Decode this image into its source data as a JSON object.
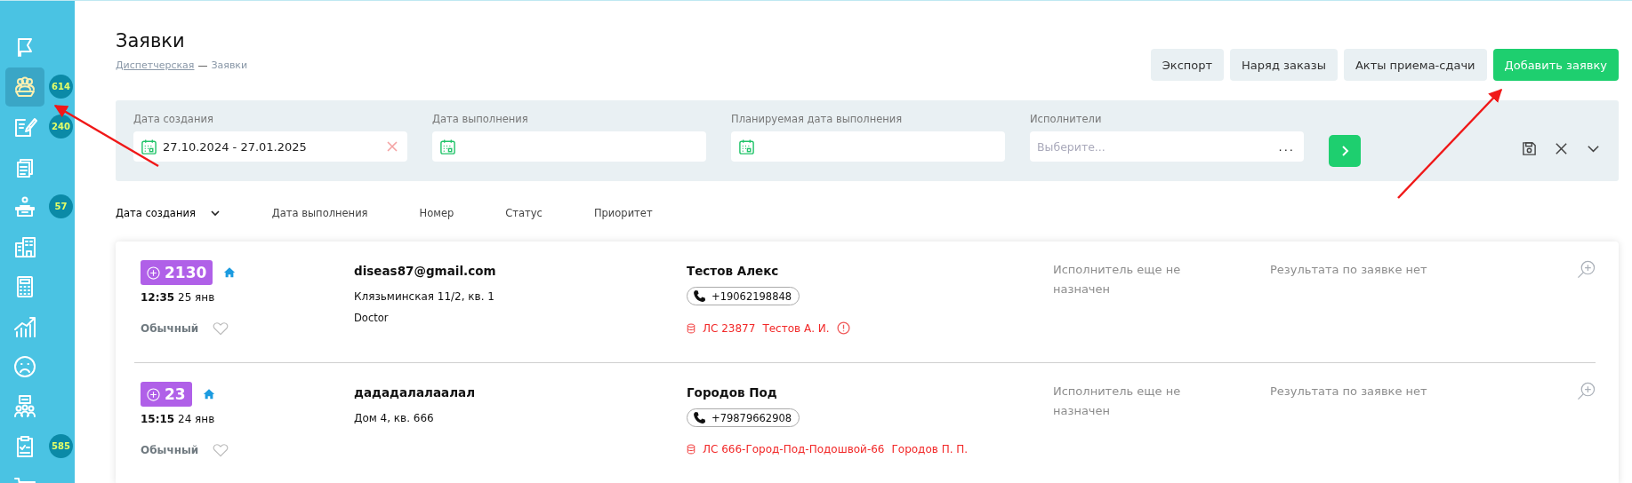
{
  "sidebar": {
    "items": [
      {
        "kind": "flag",
        "selected": false
      },
      {
        "kind": "group",
        "selected": true,
        "badge": "614"
      },
      {
        "kind": "edit",
        "selected": false,
        "badge": "240"
      },
      {
        "kind": "docs",
        "selected": false
      },
      {
        "kind": "reception",
        "selected": false,
        "badge": "57"
      },
      {
        "kind": "building",
        "selected": false
      },
      {
        "kind": "calculator",
        "selected": false
      },
      {
        "kind": "chart",
        "selected": false
      },
      {
        "kind": "sad",
        "selected": false
      },
      {
        "kind": "team",
        "selected": false
      },
      {
        "kind": "clipboard",
        "selected": false,
        "badge": "585"
      },
      {
        "kind": "cart",
        "selected": false
      }
    ]
  },
  "page": {
    "title": "Заявки",
    "breadcrumb": {
      "parent": "Диспетчерская",
      "separator": "—",
      "current": "Заявки"
    }
  },
  "toolbar": {
    "buttons": [
      {
        "label": "Экспорт",
        "kind": "secondary"
      },
      {
        "label": "Наряд заказы",
        "kind": "secondary"
      },
      {
        "label": "Акты приема-сдачи",
        "kind": "secondary"
      },
      {
        "label": "Добавить заявку",
        "kind": "primary"
      }
    ]
  },
  "filters": {
    "fields": [
      {
        "kind": "date",
        "label": "Дата создания",
        "value": "27.10.2024 - 27.01.2025",
        "clearable": true
      },
      {
        "kind": "date",
        "label": "Дата выполнения",
        "clearable": false
      },
      {
        "kind": "date",
        "label": "Планируемая дата выполнения",
        "clearable": false
      },
      {
        "kind": "select",
        "label": "Исполнители",
        "placeholder": "Выберите...",
        "more": "..."
      }
    ]
  },
  "sort": [
    {
      "label": "Дата создания",
      "selected": true
    },
    {
      "label": "Дата выполнения",
      "selected": false
    },
    {
      "label": "Номер",
      "selected": false
    },
    {
      "label": "Статус",
      "selected": false
    },
    {
      "label": "Приоритет",
      "selected": false
    }
  ],
  "requests": [
    {
      "number": "2130",
      "time": "12:35",
      "date": "25 янв",
      "priority": "Обычный",
      "favorite": false,
      "client": "diseas87@gmail.com",
      "address": "Клязьминская 11/2, кв. 1",
      "note": "Doctor",
      "contact": "Тестов Алекс",
      "phone": "+19062198848",
      "account": "ЛС 23877",
      "owner": "Тестов А. И.",
      "warning": true,
      "executor": "Исполнитель еще не назначен",
      "result": "Результата по заявке нет"
    },
    {
      "number": "23",
      "time": "15:15",
      "date": "24 янв",
      "priority": "Обычный",
      "favorite": false,
      "client": "дададалалаалал",
      "address": "Дом 4, кв. 666",
      "contact": "Городов Под",
      "phone": "+79879662908",
      "account": "ЛС 666-Город-Под-Подошвой-66",
      "owner": "Городов П. П.",
      "warning": false,
      "executor": "Исполнитель еще не назначен",
      "result": "Результата по заявке нет"
    }
  ]
}
